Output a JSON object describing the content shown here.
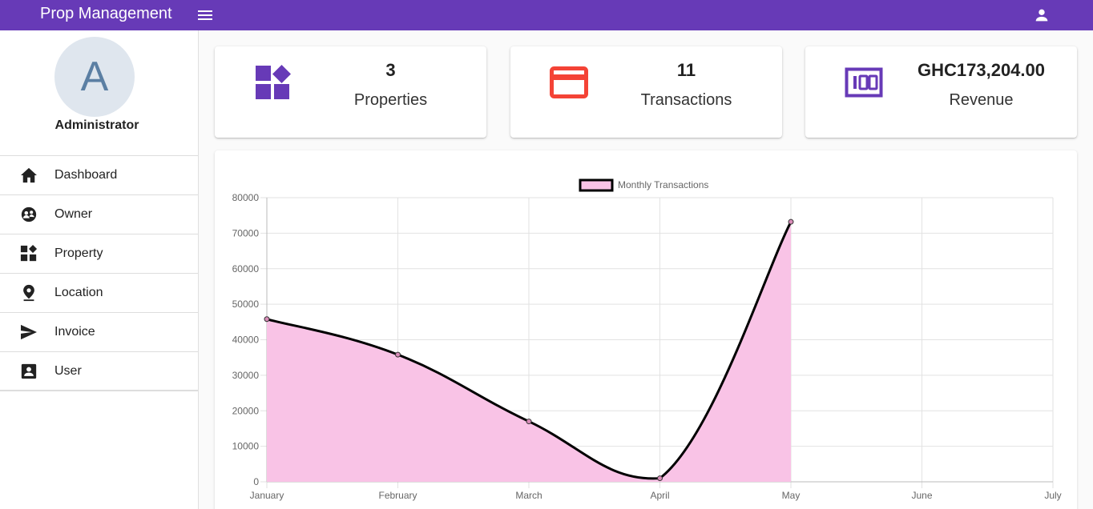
{
  "header": {
    "title": "Prop Management"
  },
  "sidebar": {
    "avatar_letter": "A",
    "role": "Administrator",
    "items": [
      {
        "label": "Dashboard",
        "icon": "home-icon"
      },
      {
        "label": "Owner",
        "icon": "owner-icon"
      },
      {
        "label": "Property",
        "icon": "widgets-icon"
      },
      {
        "label": "Location",
        "icon": "location-pin-icon"
      },
      {
        "label": "Invoice",
        "icon": "send-icon"
      },
      {
        "label": "User",
        "icon": "account-box-icon"
      }
    ]
  },
  "stats": [
    {
      "value": "3",
      "label": "Properties",
      "icon": "widgets-icon",
      "color": "#673ab7"
    },
    {
      "value": "11",
      "label": "Transactions",
      "icon": "credit-card-icon",
      "color": "#f44336"
    },
    {
      "value": "GHC173,204.00",
      "label": "Revenue",
      "icon": "money-icon",
      "color": "#673ab7"
    }
  ],
  "colors": {
    "primary": "#673ab7",
    "accent": "#f44336",
    "chart_fill": "#f9c3e6",
    "chart_line": "#000000"
  },
  "chart_data": {
    "type": "area",
    "categories": [
      "January",
      "February",
      "March",
      "April",
      "May",
      "June",
      "July"
    ],
    "series": [
      {
        "name": "Monthly Transactions",
        "values": [
          45800,
          35800,
          17000,
          1000,
          73200,
          null,
          null
        ]
      }
    ],
    "ylim": [
      0,
      80000
    ],
    "yticks": [
      0,
      10000,
      20000,
      30000,
      40000,
      50000,
      60000,
      70000,
      80000
    ],
    "grid": true,
    "legend": "top-center"
  }
}
